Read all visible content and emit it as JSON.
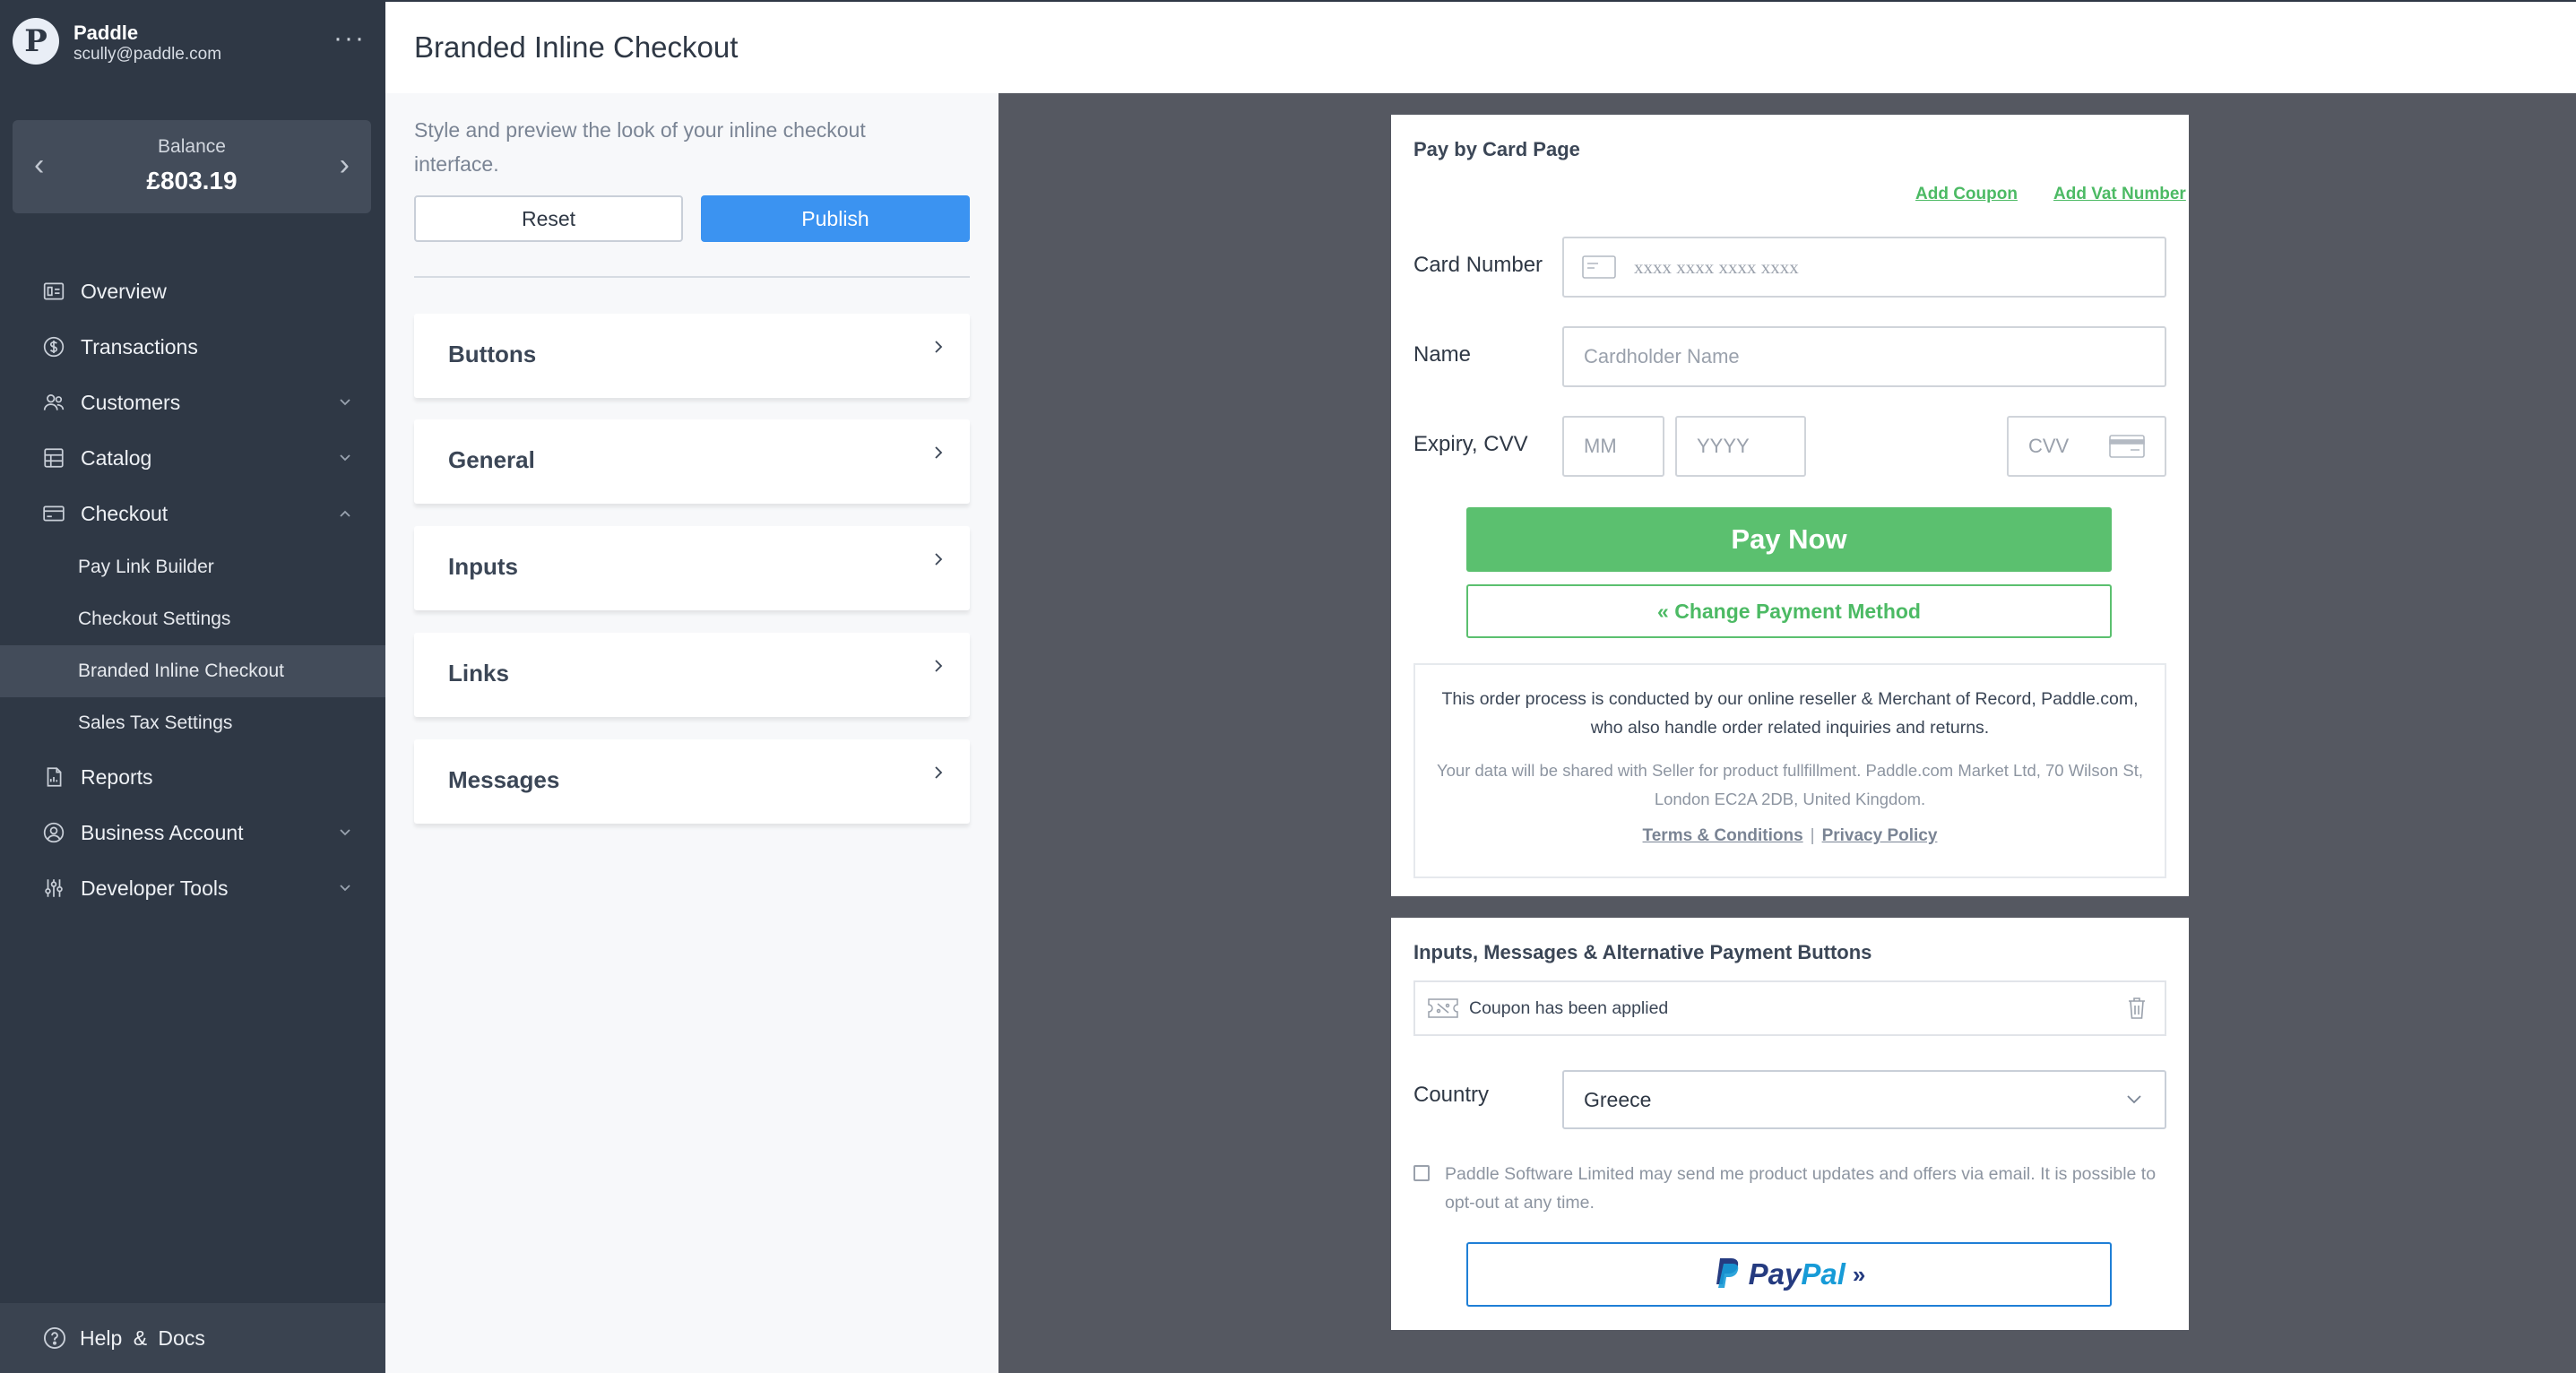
{
  "account": {
    "logo_letter": "P",
    "name": "Paddle",
    "email": "scully@paddle.com",
    "more_glyph": "···"
  },
  "balance": {
    "label": "Balance",
    "value": "£803.19",
    "prev_glyph": "‹",
    "next_glyph": "›"
  },
  "nav": {
    "overview": "Overview",
    "transactions": "Transactions",
    "customers": "Customers",
    "catalog": "Catalog",
    "checkout": "Checkout",
    "checkout_sub": [
      "Pay Link Builder",
      "Checkout Settings",
      "Branded Inline Checkout",
      "Sales Tax Settings"
    ],
    "active_sub": "Branded Inline Checkout",
    "reports": "Reports",
    "business_account": "Business Account",
    "developer_tools": "Developer Tools"
  },
  "help": {
    "label": "Help & Docs"
  },
  "header": {
    "title": "Branded Inline Checkout"
  },
  "panel": {
    "description": "Style and preview the look of your inline checkout interface.",
    "reset_label": "Reset",
    "publish_label": "Publish",
    "sections": [
      "Buttons",
      "General",
      "Inputs",
      "Links",
      "Messages"
    ]
  },
  "preview": {
    "card1": {
      "title": "Pay by Card Page",
      "add_coupon": "Add Coupon",
      "add_vat": "Add Vat Number",
      "card_number_label": "Card Number",
      "card_number_placeholder": "xxxx xxxx xxxx xxxx",
      "name_label": "Name",
      "name_placeholder": "Cardholder Name",
      "expiry_label": "Expiry, CVV",
      "mm_placeholder": "MM",
      "yyyy_placeholder": "YYYY",
      "cvv_placeholder": "CVV",
      "pay_now": "Pay Now",
      "change_method": "« Change Payment Method",
      "notice_main": "This order process is conducted by our online reseller & Merchant of Record, Paddle.com, who also handle order related inquiries and returns.",
      "notice_sub": "Your data will be shared with Seller for product fullfillment. Paddle.com Market Ltd, 70 Wilson St, London EC2A 2DB, United Kingdom.",
      "terms": "Terms & Conditions",
      "separator": "|",
      "privacy": "Privacy Policy"
    },
    "card2": {
      "title": "Inputs, Messages & Alternative Payment Buttons",
      "coupon_applied": "Coupon has been applied",
      "country_label": "Country",
      "country_value": "Greece",
      "optin_text": "Paddle Software Limited may send me product updates and offers via email. It is possible to opt-out at any time.",
      "paypal_a": "Pay",
      "paypal_b": "Pal",
      "paypal_arrow": "»"
    }
  },
  "colors": {
    "sidebar_bg": "#2f3845",
    "accent_blue": "#3b93f1",
    "pay_green": "#5bc06f",
    "preview_bg": "#555861",
    "paypal_dark": "#253b80",
    "paypal_light": "#179bd7"
  },
  "icons": {
    "overview": "overview-icon",
    "transactions": "dollar-circle-icon",
    "customers": "users-icon",
    "catalog": "catalog-icon",
    "checkout": "credit-card-icon",
    "reports": "report-icon",
    "business_account": "user-circle-icon",
    "developer_tools": "sliders-icon",
    "help": "question-circle-icon"
  }
}
